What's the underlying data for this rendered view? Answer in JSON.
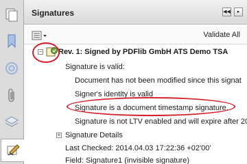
{
  "panel": {
    "title": "Signatures",
    "validate_all": "Validate All"
  },
  "rail": {
    "items": [
      "pages-icon",
      "bookmark-icon",
      "attachments-icon",
      "paperclip-icon",
      "layers-icon",
      "signatures-icon"
    ]
  },
  "tree": {
    "revision": "Rev. 1: Signed by PDFlib GmbH ATS Demo TSA",
    "validity": "Signature is valid:",
    "details": [
      "Document has not been modified since this signat",
      "Signer's identity is valid",
      "Signature is a document timestamp signature.",
      "Signature is not LTV enabled and will expire after 20"
    ],
    "signature_details": "Signature Details",
    "last_checked": "Last Checked: 2014.04.03 17:22:36 +02'00'",
    "field": "Field: Signature1 (invisible signature)"
  },
  "colors": {
    "annotation": "#d5202b",
    "rail_bg": "#dcdcdc"
  }
}
